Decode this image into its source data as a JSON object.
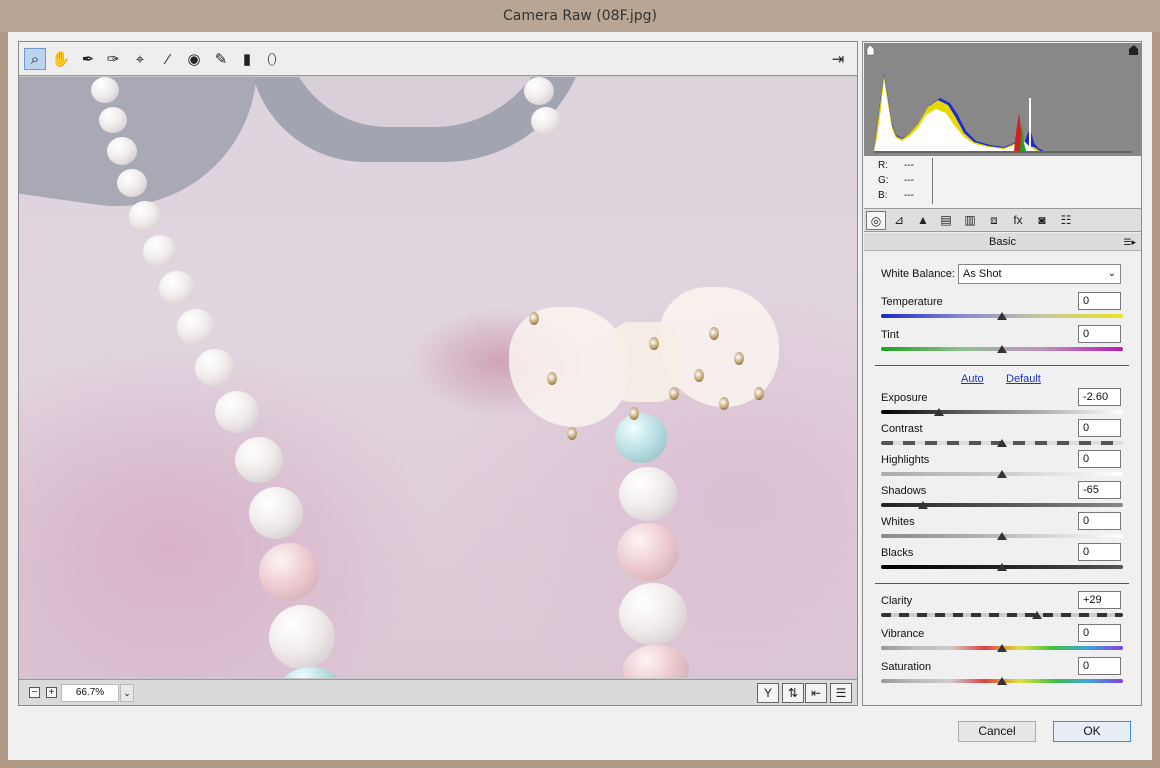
{
  "window": {
    "title": "Camera Raw (08F.jpg)"
  },
  "toolbar": {
    "tools": [
      {
        "name": "zoom-tool",
        "icon": "magnifier-icon",
        "glyph": "🔍",
        "active": true
      },
      {
        "name": "hand-tool",
        "icon": "hand-icon",
        "glyph": "✋"
      },
      {
        "name": "white-balance-tool",
        "icon": "eyedropper-icon",
        "glyph": "✒"
      },
      {
        "name": "color-sampler-tool",
        "icon": "color-sampler-icon",
        "glyph": "✑"
      },
      {
        "name": "targeted-adjustment-tool",
        "icon": "target-icon",
        "glyph": "⌖"
      },
      {
        "name": "spot-removal-tool",
        "icon": "spot-removal-icon",
        "glyph": "⁄"
      },
      {
        "name": "red-eye-tool",
        "icon": "eye-icon",
        "glyph": "◉"
      },
      {
        "name": "adjustment-brush-tool",
        "icon": "brush-icon",
        "glyph": "🖌"
      },
      {
        "name": "graduated-filter-tool",
        "icon": "graduated-filter-icon",
        "glyph": "▮"
      },
      {
        "name": "radial-filter-tool",
        "icon": "radial-filter-icon",
        "glyph": "⬯"
      }
    ],
    "export_icon": "export-icon"
  },
  "zoom": {
    "value": "66.7%"
  },
  "readout": {
    "r_label": "R:",
    "r_value": "---",
    "g_label": "G:",
    "g_value": "---",
    "b_label": "B:",
    "b_value": "---"
  },
  "panel": {
    "title": "Basic",
    "white_balance": {
      "label": "White Balance:",
      "value": "As Shot"
    },
    "auto_label": "Auto",
    "default_label": "Default",
    "sliders": [
      {
        "key": "temperature",
        "label": "Temperature",
        "value": "0",
        "level": 0.5
      },
      {
        "key": "tint",
        "label": "Tint",
        "value": "0",
        "level": 0.5
      },
      {
        "key": "exposure",
        "label": "Exposure",
        "value": "-2.60",
        "level": 0.24
      },
      {
        "key": "contrast",
        "label": "Contrast",
        "value": "0",
        "level": 0.5
      },
      {
        "key": "highlights",
        "label": "Highlights",
        "value": "0",
        "level": 0.5
      },
      {
        "key": "shadows",
        "label": "Shadows",
        "value": "-65",
        "level": 0.175
      },
      {
        "key": "whites",
        "label": "Whites",
        "value": "0",
        "level": 0.5
      },
      {
        "key": "blacks",
        "label": "Blacks",
        "value": "0",
        "level": 0.5
      },
      {
        "key": "clarity",
        "label": "Clarity",
        "value": "+29",
        "level": 0.645
      },
      {
        "key": "vibrance",
        "label": "Vibrance",
        "value": "0",
        "level": 0.5
      },
      {
        "key": "saturation",
        "label": "Saturation",
        "value": "0",
        "level": 0.5
      }
    ]
  },
  "buttons": {
    "cancel": "Cancel",
    "ok": "OK"
  },
  "colors": {
    "accent": "#3b8fd9",
    "link": "#1a34c8"
  }
}
